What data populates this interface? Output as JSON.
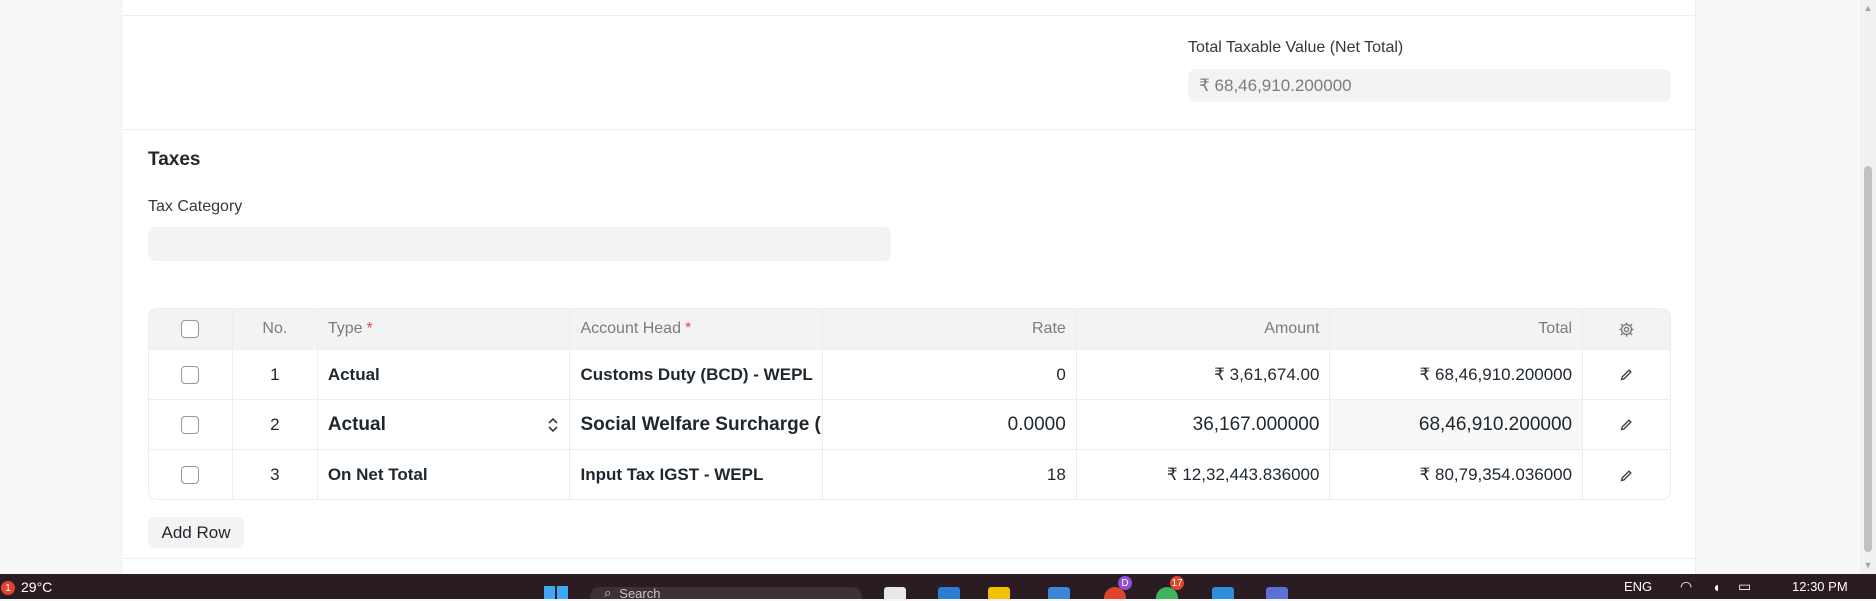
{
  "summary": {
    "net_total_label": "Total Taxable Value (Net Total)",
    "net_total_value": "₹ 68,46,910.200000"
  },
  "taxes": {
    "section_title": "Taxes",
    "tax_category_label": "Tax Category",
    "tax_category_value": "",
    "columns": {
      "no": "No.",
      "type": "Type",
      "account_head": "Account Head",
      "rate": "Rate",
      "amount": "Amount",
      "total": "Total",
      "required_marker": "*"
    },
    "rows": [
      {
        "no": "1",
        "type": "Actual",
        "account_head": "Customs Duty (BCD) - WEPL",
        "rate": "0",
        "amount": "₹ 3,61,674.00",
        "total": "₹ 68,46,910.200000"
      },
      {
        "no": "2",
        "type": "Actual",
        "account_head": "Social Welfare Surcharge (",
        "rate": "0.0000",
        "amount": "36,167.000000",
        "total": "68,46,910.200000"
      },
      {
        "no": "3",
        "type": "On Net Total",
        "account_head": "Input Tax IGST - WEPL",
        "rate": "18",
        "amount": "₹ 12,32,443.836000",
        "total": "₹ 80,79,354.036000"
      }
    ],
    "add_row_label": "Add Row"
  },
  "taskbar": {
    "weather_badge": "1",
    "temperature": "29°C",
    "search_placeholder": "Search",
    "badge_d": "D",
    "badge_17": "17",
    "language": "ENG",
    "time": "12:30 PM"
  },
  "colors": {
    "accent_required": "#e24c4c",
    "field_bg": "#f3f3f3",
    "taskbar_bg": "#2a1c22"
  },
  "icons": [
    "settings-gear-icon",
    "edit-pencil-icon",
    "select-chevron-icon",
    "windows-start-icon",
    "search-icon"
  ]
}
